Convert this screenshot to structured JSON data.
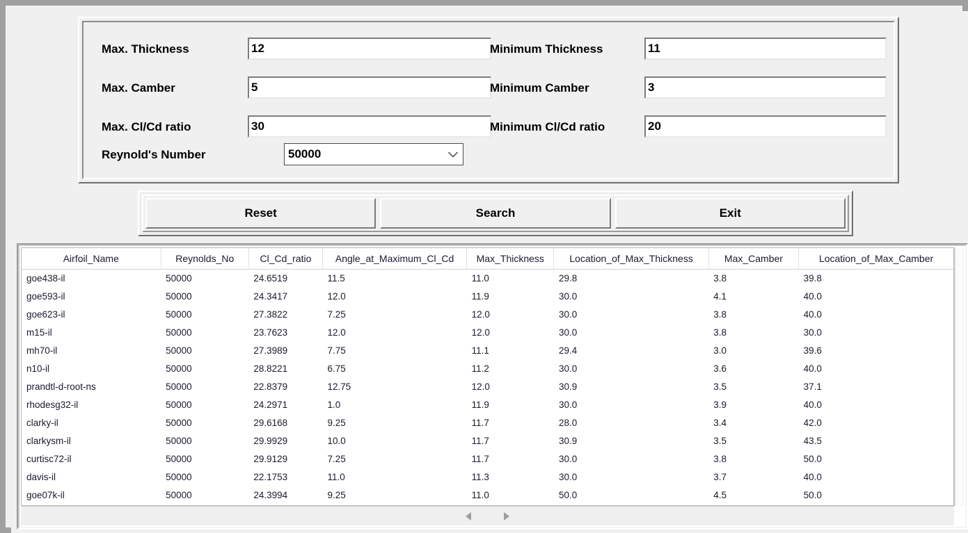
{
  "form": {
    "fields": [
      {
        "label": "Max. Thickness",
        "value": "12"
      },
      {
        "label": "Max. Camber",
        "value": "5"
      },
      {
        "label": "Max. Cl/Cd ratio",
        "value": "30"
      },
      {
        "label": "Minimum Thickness",
        "value": "11"
      },
      {
        "label": "Minimum Camber",
        "value": "3"
      },
      {
        "label": "Minimum Cl/Cd ratio",
        "value": "20"
      }
    ],
    "reynolds": {
      "label": "Reynold's Number",
      "selected": "50000",
      "arrow_icon": "chevron-down-icon"
    }
  },
  "buttons": {
    "reset": "Reset",
    "search": "Search",
    "exit": "Exit"
  },
  "table": {
    "columns": [
      "Airfoil_Name",
      "Reynolds_No",
      "Cl_Cd_ratio",
      "Angle_at_Maximum_Cl_Cd",
      "Max_Thickness",
      "Location_of_Max_Thickness",
      "Max_Camber",
      "Location_of_Max_Camber"
    ],
    "rows": [
      [
        "goe438-il",
        "50000",
        "24.6519",
        "11.5",
        "11.0",
        "29.8",
        "3.8",
        "39.8"
      ],
      [
        "goe593-il",
        "50000",
        "24.3417",
        "12.0",
        "11.9",
        "30.0",
        "4.1",
        "40.0"
      ],
      [
        "goe623-il",
        "50000",
        "27.3822",
        "7.25",
        "12.0",
        "30.0",
        "3.8",
        "40.0"
      ],
      [
        "m15-il",
        "50000",
        "23.7623",
        "12.0",
        "12.0",
        "30.0",
        "3.8",
        "30.0"
      ],
      [
        "mh70-il",
        "50000",
        "27.3989",
        "7.75",
        "11.1",
        "29.4",
        "3.0",
        "39.6"
      ],
      [
        "n10-il",
        "50000",
        "28.8221",
        "6.75",
        "11.2",
        "30.0",
        "3.6",
        "40.0"
      ],
      [
        "prandtl-d-root-ns",
        "50000",
        "22.8379",
        "12.75",
        "12.0",
        "30.9",
        "3.5",
        "37.1"
      ],
      [
        "rhodesg32-il",
        "50000",
        "24.2971",
        "1.0",
        "11.9",
        "30.0",
        "3.9",
        "40.0"
      ],
      [
        "clarky-il",
        "50000",
        "29.6168",
        "9.25",
        "11.7",
        "28.0",
        "3.4",
        "42.0"
      ],
      [
        "clarkysm-il",
        "50000",
        "29.9929",
        "10.0",
        "11.7",
        "30.9",
        "3.5",
        "43.5"
      ],
      [
        "curtisc72-il",
        "50000",
        "29.9129",
        "7.25",
        "11.7",
        "30.0",
        "3.8",
        "50.0"
      ],
      [
        "davis-il",
        "50000",
        "22.1753",
        "11.0",
        "11.3",
        "30.0",
        "3.7",
        "40.0"
      ],
      [
        "goe07k-il",
        "50000",
        "24.3994",
        "9.25",
        "11.0",
        "50.0",
        "4.5",
        "50.0"
      ]
    ]
  },
  "scrollbar": {
    "left_arrow_icon": "triangle-left-icon",
    "right_arrow_icon": "triangle-right-icon"
  },
  "colors": {
    "window_border": "#a0a0a0",
    "panel_face": "#f0f0f0",
    "table_background": "#ffffff",
    "text": "#000000",
    "table_text": "#1a1a2e"
  }
}
